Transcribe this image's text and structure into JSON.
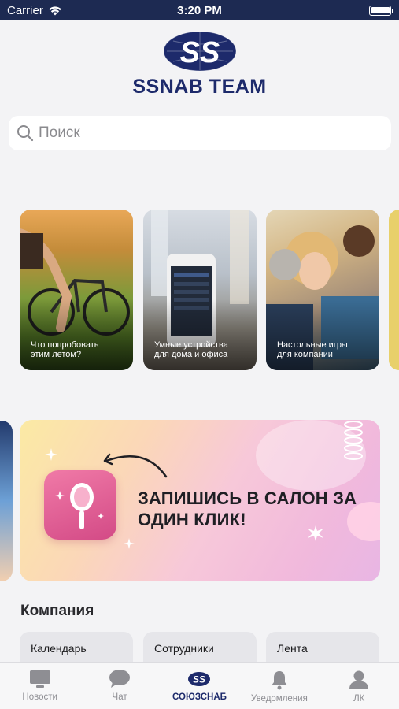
{
  "status_bar": {
    "carrier": "Carrier",
    "time": "3:20 PM"
  },
  "logo": {
    "text": "SSNAB TEAM"
  },
  "search": {
    "placeholder": "Поиск"
  },
  "stories": [
    {
      "label": "Что попробовать этим летом?"
    },
    {
      "label": "Умные устройства для дома и офиса"
    },
    {
      "label": "Настольные игры для компании"
    }
  ],
  "banner": {
    "title": "ЗАПИШИСЬ В САЛОН ЗА ОДИН КЛИК!"
  },
  "company": {
    "title": "Компания",
    "cards": [
      "Календарь",
      "Сотрудники",
      "Лента"
    ]
  },
  "tabbar": {
    "tabs": [
      {
        "label": "Новости",
        "icon": "news-icon"
      },
      {
        "label": "Чат",
        "icon": "chat-icon"
      },
      {
        "label": "СОЮЗСНАБ",
        "icon": "soyuzsnab-logo-icon",
        "active": true
      },
      {
        "label": "Уведомления",
        "icon": "bell-icon"
      },
      {
        "label": "ЛК",
        "icon": "profile-icon"
      }
    ]
  },
  "colors": {
    "accent": "#1d2a6b",
    "status_bar": "#1d2a52",
    "background": "#f3f3f5"
  }
}
